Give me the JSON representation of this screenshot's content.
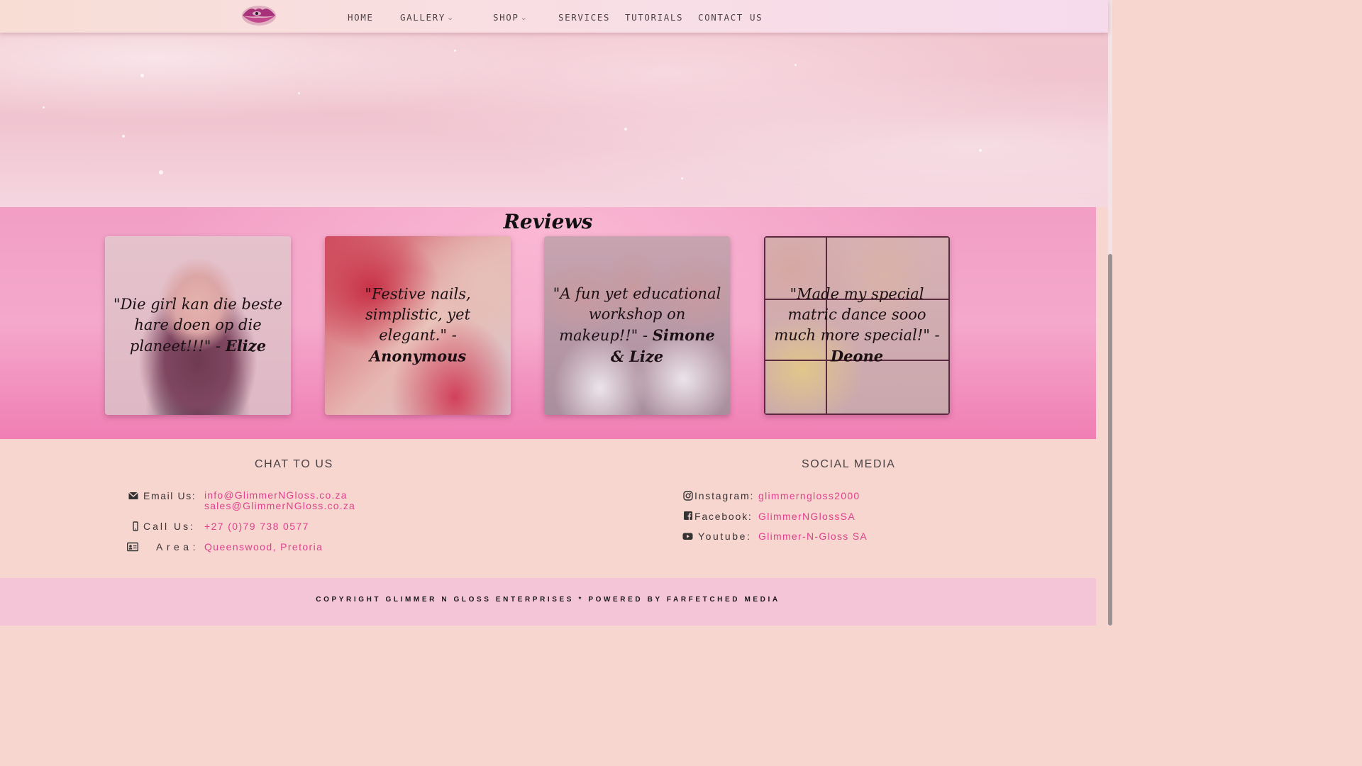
{
  "nav": {
    "items": [
      {
        "label": "HOME",
        "has_dropdown": false
      },
      {
        "label": "GALLERY",
        "has_dropdown": true
      },
      {
        "label": "SHOP",
        "has_dropdown": true
      },
      {
        "label": "SERVICES",
        "has_dropdown": false
      },
      {
        "label": "TUTORIALS",
        "has_dropdown": false
      },
      {
        "label": "CONTACT US",
        "has_dropdown": false
      }
    ]
  },
  "reviews": {
    "title": "Reviews",
    "cards": [
      {
        "quote": "\"Die girl kan die beste hare doen op die planeet!!!\" - ",
        "author": "Elize"
      },
      {
        "quote": "\"Festive nails, simplistic, yet elegant.\" - ",
        "author": "Anonymous"
      },
      {
        "quote": "\"A fun yet educational workshop on makeup!!\" - ",
        "author": "Simone & Lize"
      },
      {
        "quote": "\"Made my special matric dance sooo much more special!\" - ",
        "author": "Deone"
      }
    ]
  },
  "contact": {
    "title": "CHAT TO US",
    "email_label": "Email Us:",
    "emails": [
      "info@GlimmerNGloss.co.za",
      "sales@GlimmerNGloss.co.za"
    ],
    "phone_label": "Call Us:",
    "phone": "+27 (0)79 738 0577",
    "area_label": "Area:",
    "area": "Queenswood, Pretoria"
  },
  "social": {
    "title": "SOCIAL MEDIA",
    "instagram_label": "Instagram:",
    "instagram": "glimmerngloss2000",
    "facebook_label": "Facebook:",
    "facebook": "GlimmerNGlossSA",
    "youtube_label": "Youtube:",
    "youtube": "Glimmer-N-Gloss SA"
  },
  "footer": {
    "copyright": "COPYRIGHT GLIMMER N GLOSS ENTERPRISES * POWERED BY FARFETCHED MEDIA"
  },
  "colors": {
    "accent_pink": "#e0408e",
    "reviews_bg": "#f29ec5",
    "footer_bg": "#f6d6cf",
    "bottom_bar_bg": "#f3c5d6"
  }
}
